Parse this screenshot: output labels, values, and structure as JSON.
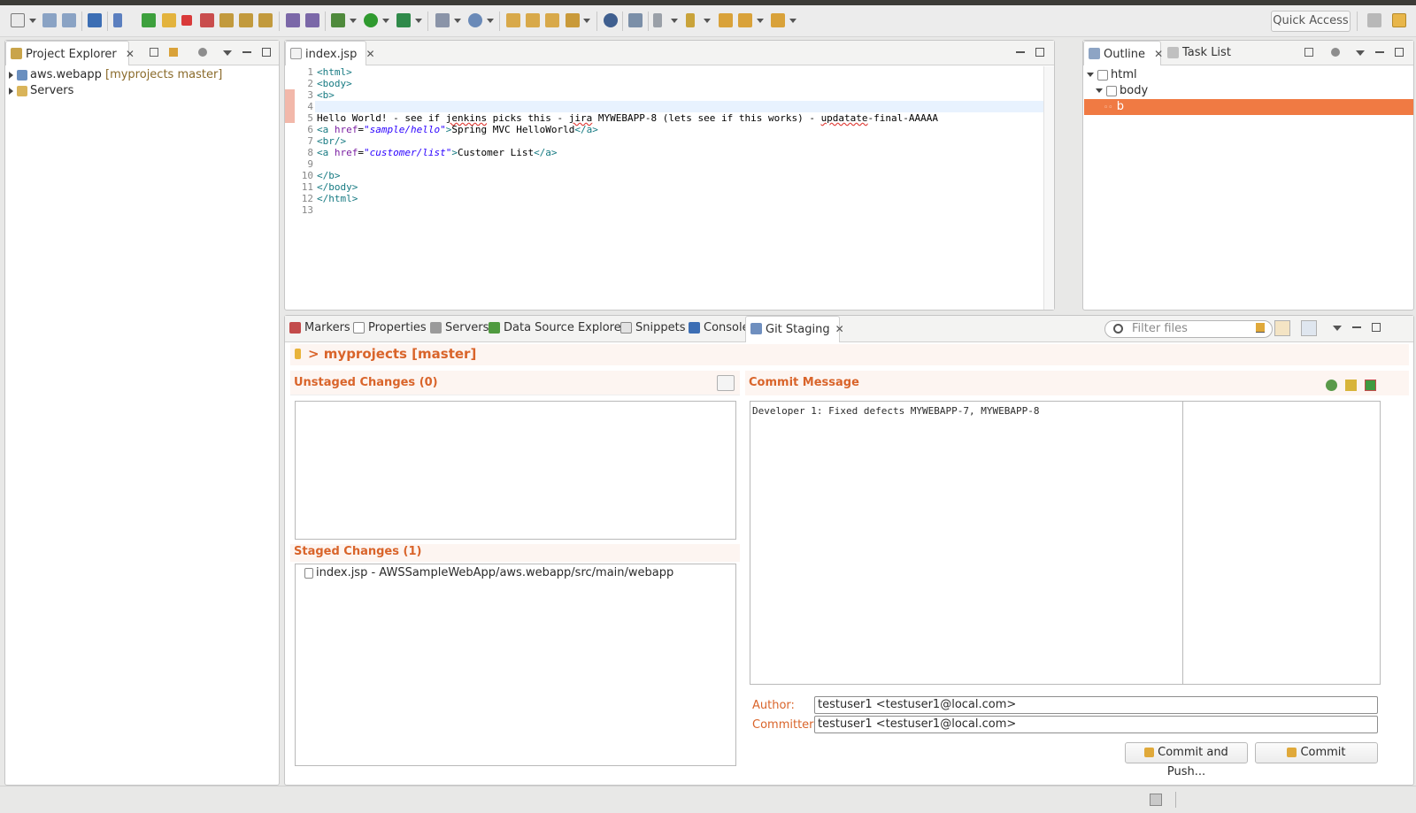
{
  "toolbar": {
    "quick_access": "Quick Access"
  },
  "project_explorer": {
    "tab_label": "Project Explorer",
    "items": [
      {
        "name": "aws.webapp",
        "decoration": "[myprojects master]"
      },
      {
        "name": "Servers"
      }
    ]
  },
  "editor": {
    "tab_label": "index.jsp",
    "line_numbers": [
      "1",
      "2",
      "3",
      "4",
      "5",
      "6",
      "7",
      "8",
      "9",
      "10",
      "11",
      "12",
      "13"
    ],
    "lines": {
      "l1": "<html>",
      "l2": "<body>",
      "l3": "<b>",
      "l4": "",
      "l5_a": "Hello World! - see if ",
      "l5_b": "jenkins",
      "l5_c": " picks this - ",
      "l5_d": "jira",
      "l5_e": " MYWEBAPP-8 (lets see if this works) - ",
      "l5_f": "updatate",
      "l5_g": "-final-AAAAA",
      "l6_tag": "<a ",
      "l6_attr": "href",
      "l6_eq": "=",
      "l6_val": "\"sample/hello\"",
      "l6_close": ">",
      "l6_text": "Spring MVC HelloWorld",
      "l6_end": "</a>",
      "l7": "<br/>",
      "l8_tag": "<a ",
      "l8_attr": "href",
      "l8_eq": "=",
      "l8_val": "\"customer/list\"",
      "l8_close": ">",
      "l8_text": "Customer List",
      "l8_end": "</a>",
      "l9": "",
      "l10": "</b>",
      "l11": "</body>",
      "l12": "</html>",
      "l13": ""
    }
  },
  "outline": {
    "tab_label": "Outline",
    "task_tab_label": "Task List",
    "nodes": {
      "html": "html",
      "body": "body",
      "b": "b"
    }
  },
  "bottom_tabs": {
    "markers": "Markers",
    "properties": "Properties",
    "servers": "Servers",
    "data_source": "Data Source Explorer",
    "snippets": "Snippets",
    "console": "Console",
    "git_staging": "Git Staging",
    "filter_placeholder": "Filter files"
  },
  "git_staging": {
    "repo_header": "> myprojects [master]",
    "unstaged_title": "Unstaged Changes (0)",
    "staged_title": "Staged Changes (1)",
    "staged_files": [
      "index.jsp - AWSSampleWebApp/aws.webapp/src/main/webapp"
    ],
    "commit_message_title": "Commit Message",
    "commit_message": "Developer 1: Fixed defects MYWEBAPP-7, MYWEBAPP-8",
    "author_label": "Author:",
    "author_value": "testuser1 <testuser1@local.com>",
    "committer_label": "Committer:",
    "committer_value": "testuser1 <testuser1@local.com>",
    "commit_and_push": "Commit and Push...",
    "commit": "Commit"
  },
  "colors": {
    "accent": "#d9642a",
    "selection": "#f07a43",
    "current_line": "#e8f2fe"
  }
}
